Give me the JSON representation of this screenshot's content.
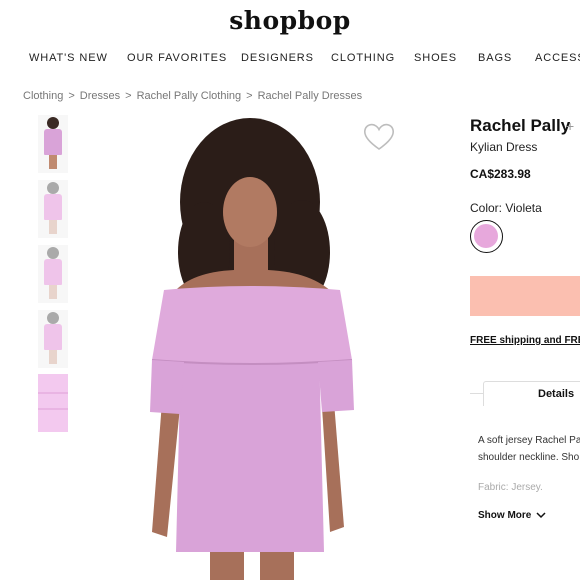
{
  "header": {
    "logo": "shopbop"
  },
  "nav": {
    "items": [
      "WHAT'S NEW",
      "OUR FAVORITES",
      "DESIGNERS",
      "CLOTHING",
      "SHOES",
      "BAGS",
      "ACCESS"
    ]
  },
  "breadcrumb": [
    "Clothing",
    "Dresses",
    "Rachel Pally Clothing",
    "Rachel Pally Dresses"
  ],
  "breadcrumb_separator": ">",
  "product": {
    "brand": "Rachel Pally",
    "brand_plus": "+",
    "name": "Kylian Dress",
    "price": "CA$283.98",
    "color_label": "Color: Violeta",
    "swatch_color": "#e7a8dc",
    "dress_color": "#d9a3d8"
  },
  "cta": {
    "add_button_color": "#fbbfb0"
  },
  "shipping": {
    "text": "FREE shipping and FREE"
  },
  "tabs": {
    "details": "Details"
  },
  "description": {
    "line1": "A soft jersey Rachel Pa",
    "line2": "shoulder neckline. Sho",
    "fabric": "Fabric: Jersey.",
    "show_more": "Show More"
  },
  "icons": {
    "wishlist": "heart-icon",
    "show_more": "chevron-down-icon"
  }
}
